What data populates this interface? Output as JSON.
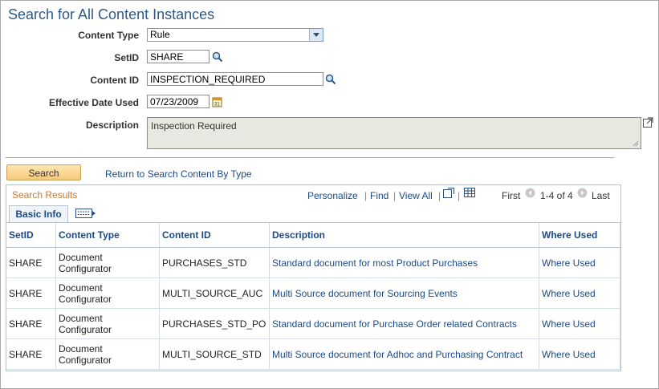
{
  "page": {
    "title": "Search for All Content Instances"
  },
  "form": {
    "content_type": {
      "label": "Content Type",
      "value": "Rule"
    },
    "setid": {
      "label": "SetID",
      "value": "SHARE"
    },
    "content_id": {
      "label": "Content ID",
      "value": "INSPECTION_REQUIRED"
    },
    "effective_date": {
      "label": "Effective Date Used",
      "value": "07/23/2009"
    },
    "description": {
      "label": "Description",
      "value": "Inspection Required"
    }
  },
  "actions": {
    "search_label": "Search",
    "return_link": "Return to Search Content By Type"
  },
  "grid": {
    "title": "Search Results",
    "personalize": "Personalize",
    "find": "Find",
    "view_all": "View All",
    "first": "First",
    "range": "1-4 of 4",
    "last": "Last",
    "tab_label": "Basic Info",
    "columns": [
      "SetID",
      "Content Type",
      "Content ID",
      "Description",
      "Where Used"
    ],
    "rows": [
      {
        "setid": "SHARE",
        "type1": "Document",
        "type2": "Configurator",
        "id": "PURCHASES_STD",
        "desc": "Standard document for most Product Purchases",
        "where": "Where Used"
      },
      {
        "setid": "SHARE",
        "type1": "Document",
        "type2": "Configurator",
        "id": "MULTI_SOURCE_AUC",
        "desc": "Multi Source document for Sourcing Events",
        "where": "Where Used"
      },
      {
        "setid": "SHARE",
        "type1": "Document",
        "type2": "Configurator",
        "id": "PURCHASES_STD_PO",
        "desc": "Standard document for Purchase Order related Contracts",
        "where": "Where Used"
      },
      {
        "setid": "SHARE",
        "type1": "Document",
        "type2": "Configurator",
        "id": "MULTI_SOURCE_STD",
        "desc": "Multi Source document for Adhoc and Purchasing Contract",
        "where": "Where Used"
      }
    ]
  }
}
